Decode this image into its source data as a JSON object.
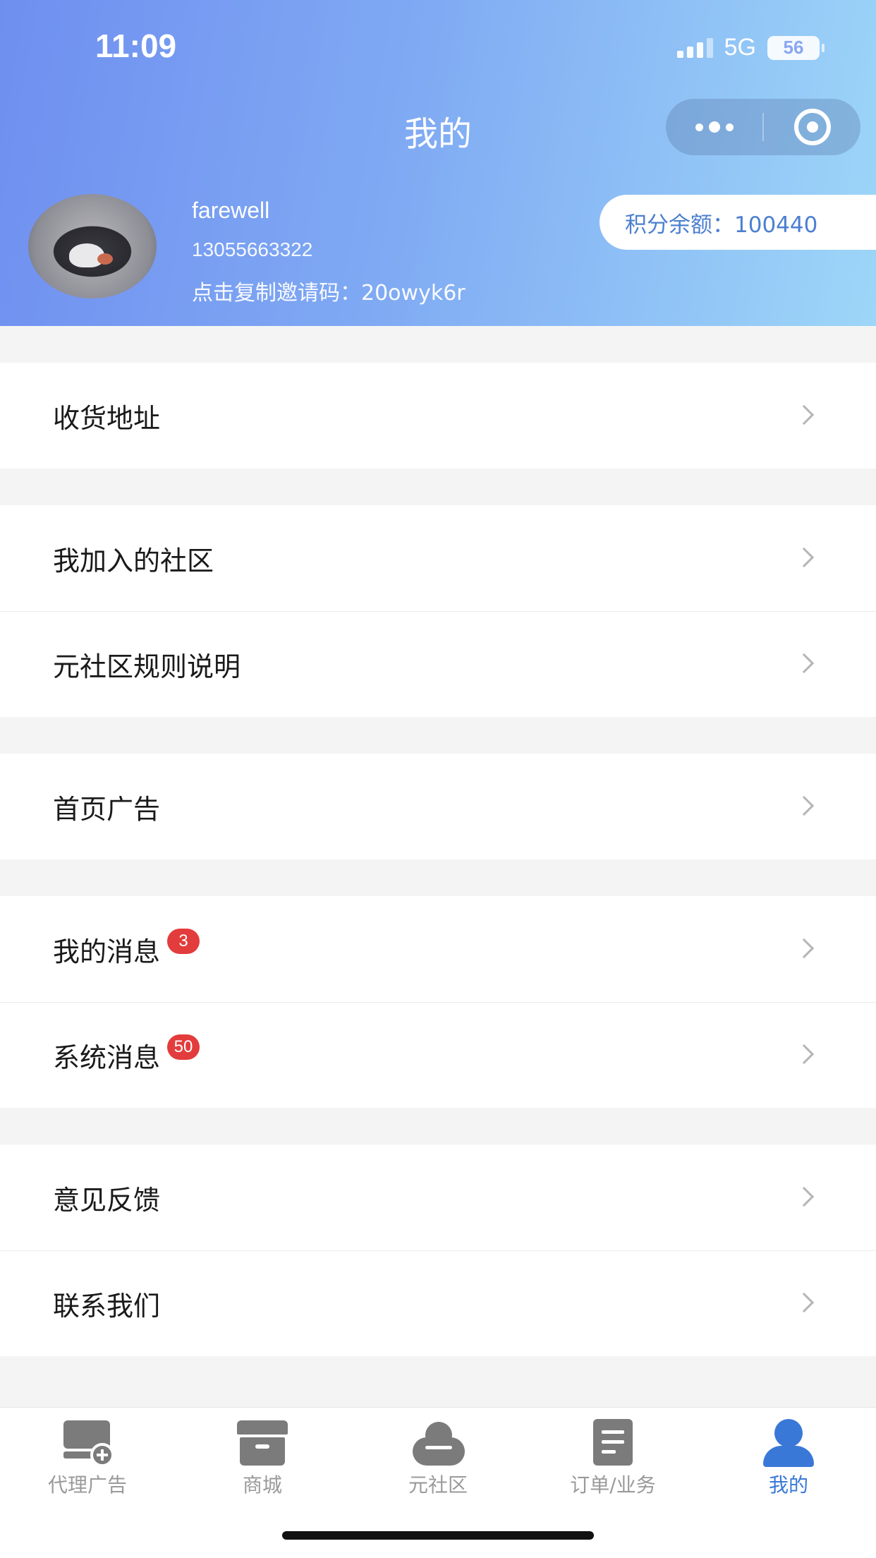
{
  "status_bar": {
    "time": "11:09",
    "network": "5G",
    "battery": "56"
  },
  "header": {
    "title": "我的",
    "user": {
      "name": "farewell",
      "phone": "13055663322",
      "invite_code_text": "点击复制邀请码：20owyk6r"
    },
    "points_text": "积分余额：100440"
  },
  "menu": {
    "groups": [
      {
        "items": [
          {
            "label": "收货地址"
          }
        ]
      },
      {
        "items": [
          {
            "label": "我加入的社区"
          },
          {
            "label": "元社区规则说明"
          }
        ]
      },
      {
        "items": [
          {
            "label": "首页广告"
          }
        ]
      },
      {
        "items": [
          {
            "label": "我的消息",
            "badge": "3"
          },
          {
            "label": "系统消息",
            "badge": "50"
          }
        ]
      },
      {
        "items": [
          {
            "label": "意见反馈"
          },
          {
            "label": "联系我们"
          }
        ]
      }
    ]
  },
  "tabbar": {
    "items": [
      {
        "label": "代理广告",
        "icon": "ad-monitor-icon"
      },
      {
        "label": "商城",
        "icon": "shop-icon"
      },
      {
        "label": "元社区",
        "icon": "community-cloud-icon"
      },
      {
        "label": "订单/业务",
        "icon": "order-document-icon"
      },
      {
        "label": "我的",
        "icon": "user-icon",
        "active": true
      }
    ]
  },
  "colors": {
    "header_gradient_start": "#6f8ff0",
    "header_gradient_end": "#9dd6f8",
    "accent": "#3a78d8",
    "badge": "#e33c3c",
    "points_text": "#4c7fd0"
  }
}
